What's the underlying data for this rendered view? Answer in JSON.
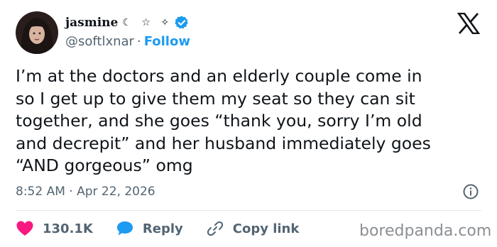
{
  "author": {
    "display_name": "jasmine",
    "name_glyphs": "☾ ☆ ✧",
    "handle": "@softlxnar",
    "separator": "·",
    "follow_label": "Follow"
  },
  "tweet": {
    "text": "I’m at the doctors and an elderly couple come in\nso I get up to give them my seat so they can sit\ntogether, and she goes “thank you, sorry I’m old\nand decrepit” and her husband immediately goes\n“AND gorgeous” omg",
    "timestamp": "8:52 AM · Apr 22, 2026"
  },
  "actions": {
    "likes": "130.1K",
    "reply_label": "Reply",
    "copy_link_label": "Copy link"
  },
  "watermark": "boredpanda.com",
  "icons": {
    "logo": "x-logo-icon",
    "verified": "verified-badge-icon",
    "info": "info-icon",
    "like": "heart-icon",
    "reply": "speech-bubble-icon",
    "copy": "link-icon"
  },
  "colors": {
    "accent": "#1d9bf0",
    "like": "#f91880",
    "text": "#0f1419",
    "muted": "#536471"
  }
}
